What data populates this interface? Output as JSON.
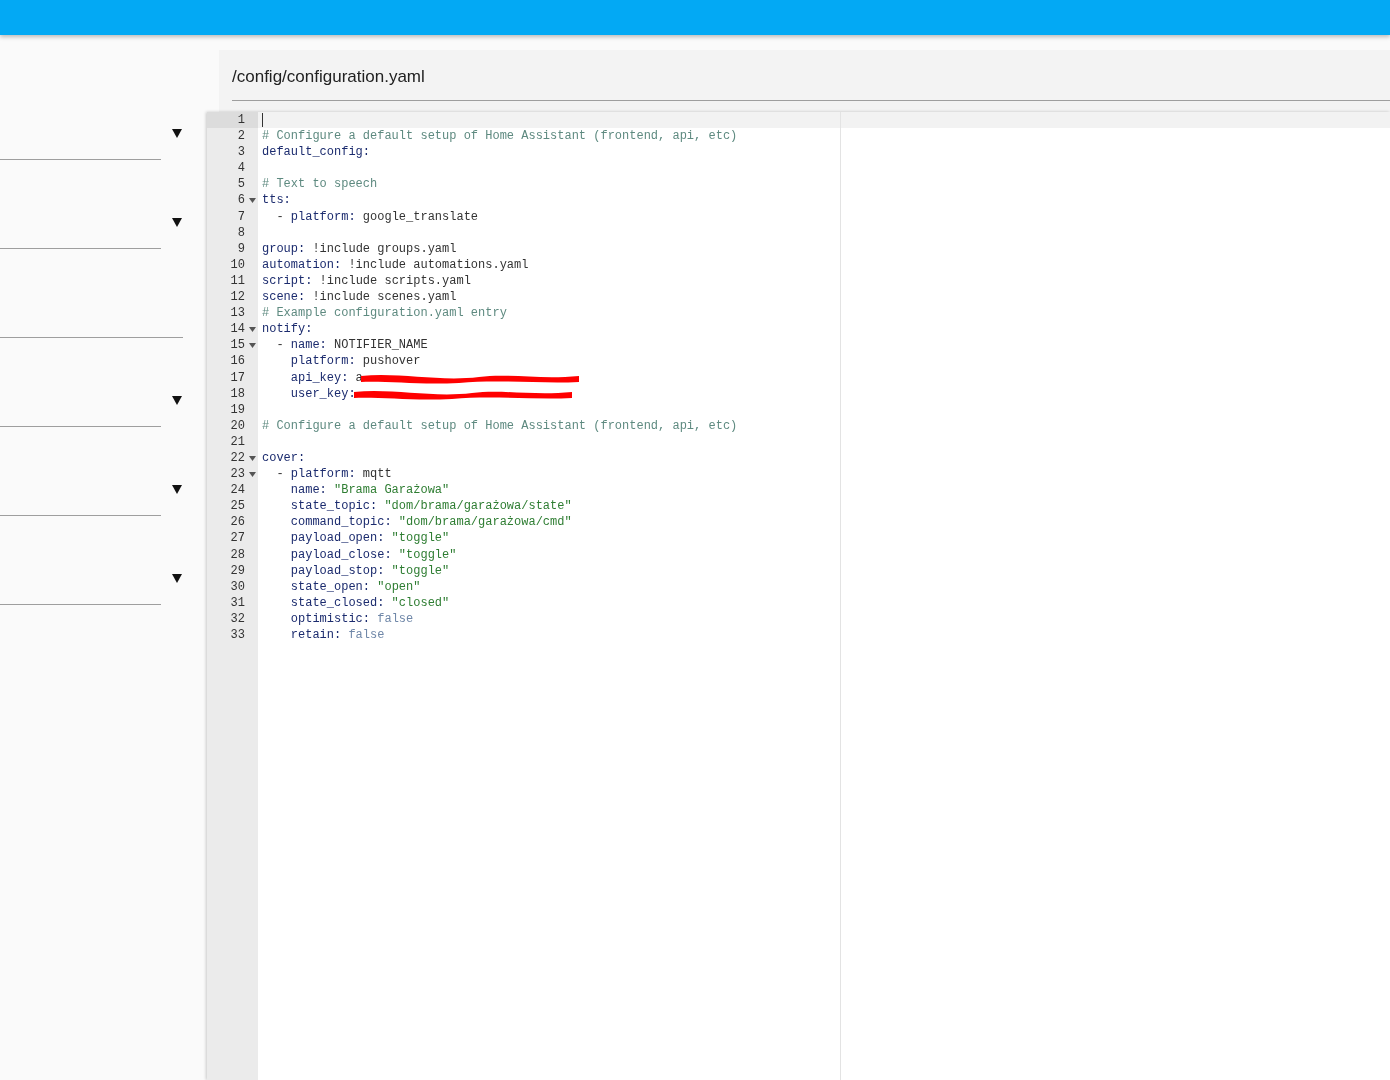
{
  "sidebar": {
    "fields": [
      {
        "kind": "dropdown"
      },
      {
        "kind": "dropdown"
      },
      {
        "kind": "text"
      },
      {
        "kind": "dropdown"
      },
      {
        "kind": "dropdown"
      },
      {
        "kind": "dropdown"
      }
    ]
  },
  "editor": {
    "title": "/config/configuration.yaml",
    "lines": [
      {
        "number": "1",
        "active": true
      },
      {
        "number": "2",
        "tokens": [
          {
            "kind": "comment",
            "text": "# Configure a default setup of Home Assistant (frontend, api, etc)"
          }
        ]
      },
      {
        "number": "3",
        "tokens": [
          {
            "kind": "key",
            "text": "default_config:"
          }
        ]
      },
      {
        "number": "4"
      },
      {
        "number": "5",
        "tokens": [
          {
            "kind": "comment",
            "text": "# Text to speech"
          }
        ]
      },
      {
        "number": "6",
        "foldable": true,
        "tokens": [
          {
            "kind": "key",
            "text": "tts:"
          }
        ]
      },
      {
        "number": "7",
        "tokens": [
          {
            "kind": "plain",
            "text": "  - "
          },
          {
            "kind": "key",
            "text": "platform:"
          },
          {
            "kind": "plain",
            "text": " google_translate"
          }
        ]
      },
      {
        "number": "8"
      },
      {
        "number": "9",
        "tokens": [
          {
            "kind": "key",
            "text": "group:"
          },
          {
            "kind": "plain",
            "text": " !include groups.yaml"
          }
        ]
      },
      {
        "number": "10",
        "tokens": [
          {
            "kind": "key",
            "text": "automation:"
          },
          {
            "kind": "plain",
            "text": " !include automations.yaml"
          }
        ]
      },
      {
        "number": "11",
        "tokens": [
          {
            "kind": "key",
            "text": "script:"
          },
          {
            "kind": "plain",
            "text": " !include scripts.yaml"
          }
        ]
      },
      {
        "number": "12",
        "tokens": [
          {
            "kind": "key",
            "text": "scene:"
          },
          {
            "kind": "plain",
            "text": " !include scenes.yaml"
          }
        ]
      },
      {
        "number": "13",
        "tokens": [
          {
            "kind": "comment",
            "text": "# Example configuration.yaml entry"
          }
        ]
      },
      {
        "number": "14",
        "foldable": true,
        "tokens": [
          {
            "kind": "key",
            "text": "notify:"
          }
        ]
      },
      {
        "number": "15",
        "foldable": true,
        "tokens": [
          {
            "kind": "plain",
            "text": "  - "
          },
          {
            "kind": "key",
            "text": "name:"
          },
          {
            "kind": "plain",
            "text": " NOTIFIER_NAME"
          }
        ]
      },
      {
        "number": "16",
        "tokens": [
          {
            "kind": "key",
            "text": "    platform:"
          },
          {
            "kind": "plain",
            "text": " pushover"
          }
        ]
      },
      {
        "number": "17",
        "redacted": true,
        "tokens": [
          {
            "kind": "key",
            "text": "    api_key:"
          },
          {
            "kind": "plain",
            "text": " a"
          }
        ]
      },
      {
        "number": "18",
        "redacted": true,
        "tokens": [
          {
            "kind": "key",
            "text": "    user_key:"
          }
        ]
      },
      {
        "number": "19"
      },
      {
        "number": "20",
        "tokens": [
          {
            "kind": "comment",
            "text": "# Configure a default setup of Home Assistant (frontend, api, etc)"
          }
        ]
      },
      {
        "number": "21"
      },
      {
        "number": "22",
        "foldable": true,
        "tokens": [
          {
            "kind": "key",
            "text": "cover:"
          }
        ]
      },
      {
        "number": "23",
        "foldable": true,
        "tokens": [
          {
            "kind": "plain",
            "text": "  - "
          },
          {
            "kind": "key",
            "text": "platform:"
          },
          {
            "kind": "plain",
            "text": " mqtt"
          }
        ]
      },
      {
        "number": "24",
        "tokens": [
          {
            "kind": "key",
            "text": "    name:"
          },
          {
            "kind": "string",
            "text": " \"Brama Garażowa\""
          }
        ]
      },
      {
        "number": "25",
        "tokens": [
          {
            "kind": "key",
            "text": "    state_topic:"
          },
          {
            "kind": "string",
            "text": " \"dom/brama/garażowa/state\""
          }
        ]
      },
      {
        "number": "26",
        "tokens": [
          {
            "kind": "key",
            "text": "    command_topic:"
          },
          {
            "kind": "string",
            "text": " \"dom/brama/garażowa/cmd\""
          }
        ]
      },
      {
        "number": "27",
        "tokens": [
          {
            "kind": "key",
            "text": "    payload_open:"
          },
          {
            "kind": "string",
            "text": " \"toggle\""
          }
        ]
      },
      {
        "number": "28",
        "tokens": [
          {
            "kind": "key",
            "text": "    payload_close:"
          },
          {
            "kind": "string",
            "text": " \"toggle\""
          }
        ]
      },
      {
        "number": "29",
        "tokens": [
          {
            "kind": "key",
            "text": "    payload_stop:"
          },
          {
            "kind": "string",
            "text": " \"toggle\""
          }
        ]
      },
      {
        "number": "30",
        "tokens": [
          {
            "kind": "key",
            "text": "    state_open:"
          },
          {
            "kind": "string",
            "text": " \"open\""
          }
        ]
      },
      {
        "number": "31",
        "tokens": [
          {
            "kind": "key",
            "text": "    state_closed:"
          },
          {
            "kind": "string",
            "text": " \"closed\""
          }
        ]
      },
      {
        "number": "32",
        "tokens": [
          {
            "kind": "key",
            "text": "    optimistic:"
          },
          {
            "kind": "bool",
            "text": " false"
          }
        ]
      },
      {
        "number": "33",
        "tokens": [
          {
            "kind": "key",
            "text": "    retain:"
          },
          {
            "kind": "bool",
            "text": " false"
          }
        ]
      }
    ]
  }
}
